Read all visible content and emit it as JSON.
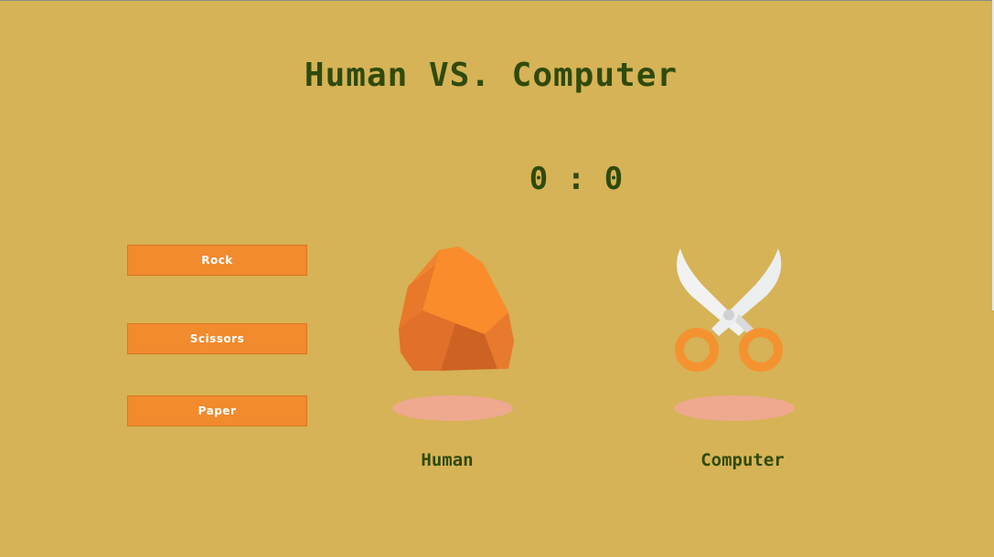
{
  "title": "Human VS. Computer",
  "score": {
    "human": "0",
    "separator": ":",
    "computer": "0"
  },
  "buttons": {
    "rock": "Rock",
    "scissors": "Scissors",
    "paper": "Paper"
  },
  "players": {
    "human": {
      "label": "Human",
      "choice_icon": "rock-icon"
    },
    "computer": {
      "label": "Computer",
      "choice_icon": "scissors-icon"
    }
  },
  "colors": {
    "background": "#d6b356",
    "text": "#2f4a0b",
    "button": "#f28a2e",
    "shadow": "#eea98e"
  }
}
